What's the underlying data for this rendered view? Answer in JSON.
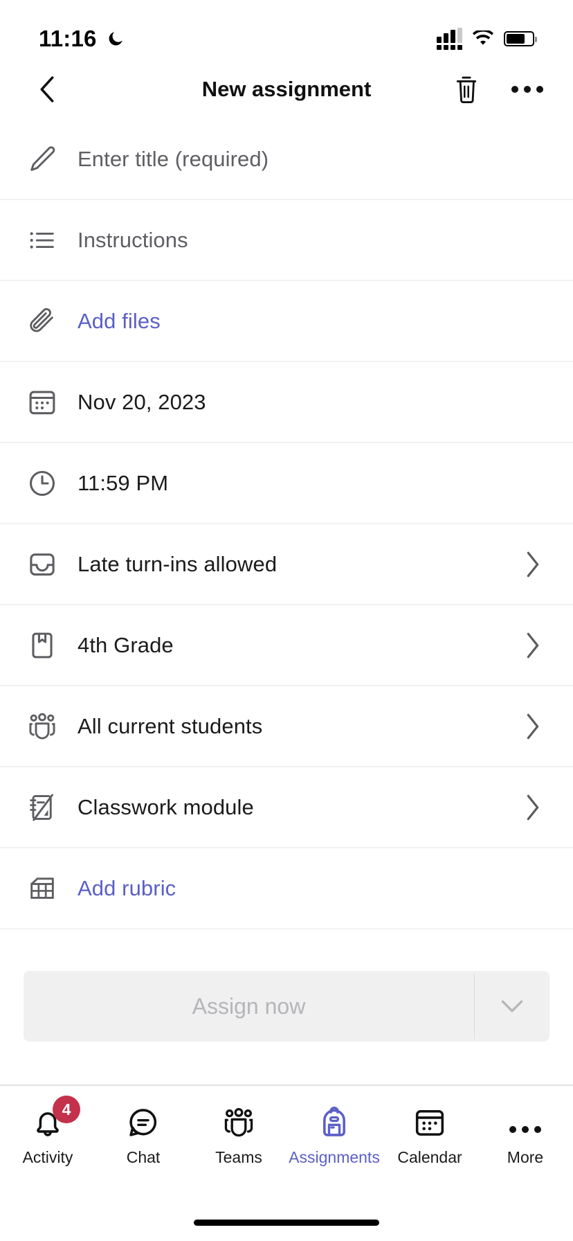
{
  "status_bar": {
    "time": "11:16",
    "moon_icon": "crescent-moon-icon",
    "signal_icon": "cellular-signal-icon",
    "wifi_icon": "wifi-icon",
    "battery_icon": "battery-icon"
  },
  "header": {
    "title": "New assignment",
    "back_icon": "chevron-left-icon",
    "delete_icon": "trash-icon",
    "more_icon": "more-horizontal-icon"
  },
  "rows": [
    {
      "icon": "pencil-icon",
      "label": "Enter title (required)",
      "style": "placeholder",
      "chevron": false,
      "name": "row-title"
    },
    {
      "icon": "bulleted-list-icon",
      "label": "Instructions",
      "style": "placeholder",
      "chevron": false,
      "name": "row-instructions"
    },
    {
      "icon": "paperclip-icon",
      "label": "Add files",
      "style": "link",
      "chevron": false,
      "name": "row-add-files"
    },
    {
      "icon": "calendar-icon",
      "label": "Nov 20, 2023",
      "style": "value",
      "chevron": false,
      "name": "row-due-date"
    },
    {
      "icon": "clock-icon",
      "label": "11:59 PM",
      "style": "value",
      "chevron": false,
      "name": "row-due-time"
    },
    {
      "icon": "inbox-icon",
      "label": "Late turn-ins allowed",
      "style": "value",
      "chevron": true,
      "name": "row-late-turn-ins"
    },
    {
      "icon": "bookmark-doc-icon",
      "label": "4th Grade",
      "style": "value",
      "chevron": true,
      "name": "row-class"
    },
    {
      "icon": "people-icon",
      "label": "All current students",
      "style": "value",
      "chevron": true,
      "name": "row-assign-to"
    },
    {
      "icon": "classwork-icon",
      "label": "Classwork module",
      "style": "value",
      "chevron": true,
      "name": "row-classwork-module"
    },
    {
      "icon": "grid-table-icon",
      "label": "Add rubric",
      "style": "link",
      "chevron": false,
      "name": "row-add-rubric"
    }
  ],
  "footer": {
    "assign_label": "Assign now",
    "caret_icon": "chevron-down-icon",
    "disabled": true
  },
  "tabbar": {
    "items": [
      {
        "icon": "bell-icon",
        "label": "Activity",
        "badge": "4",
        "active": false,
        "name": "tab-activity"
      },
      {
        "icon": "chat-icon",
        "label": "Chat",
        "badge": "",
        "active": false,
        "name": "tab-chat"
      },
      {
        "icon": "people-icon",
        "label": "Teams",
        "badge": "",
        "active": false,
        "name": "tab-teams"
      },
      {
        "icon": "backpack-icon",
        "label": "Assignments",
        "badge": "",
        "active": true,
        "name": "tab-assignments"
      },
      {
        "icon": "calendar-icon",
        "label": "Calendar",
        "badge": "",
        "active": false,
        "name": "tab-calendar"
      },
      {
        "icon": "more-horizontal-icon",
        "label": "More",
        "badge": "",
        "active": false,
        "name": "tab-more"
      }
    ]
  },
  "colors": {
    "accent": "#5b5fc7",
    "badge": "#c4314b",
    "text": "#1b1b1c",
    "muted": "#5e5e63",
    "divider": "#f2f2f3",
    "disabled_bg": "#f0f0f0",
    "disabled_text": "#b5b5ba"
  }
}
